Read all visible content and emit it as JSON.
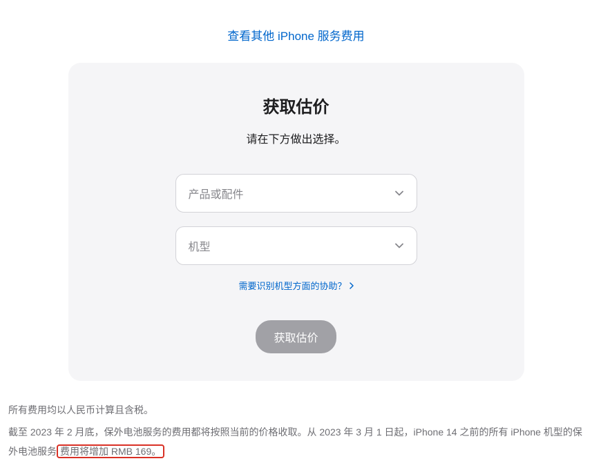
{
  "topLink": {
    "label": "查看其他 iPhone 服务费用"
  },
  "card": {
    "title": "获取估价",
    "subtitle": "请在下方做出选择。",
    "select1": {
      "placeholder": "产品或配件"
    },
    "select2": {
      "placeholder": "机型"
    },
    "helpLink": {
      "label": "需要识别机型方面的协助？"
    },
    "button": {
      "label": "获取估价"
    }
  },
  "footer": {
    "line1": "所有费用均以人民币计算且含税。",
    "line2_part1": "截至 2023 年 2 月底，保外电池服务的费用都将按照当前的价格收取。从 2023 年 3 月 1 日起，iPhone 14 之前的所有 iPhone 机型的保外电池服务",
    "line2_highlight": "费用将增加 RMB 169。"
  }
}
